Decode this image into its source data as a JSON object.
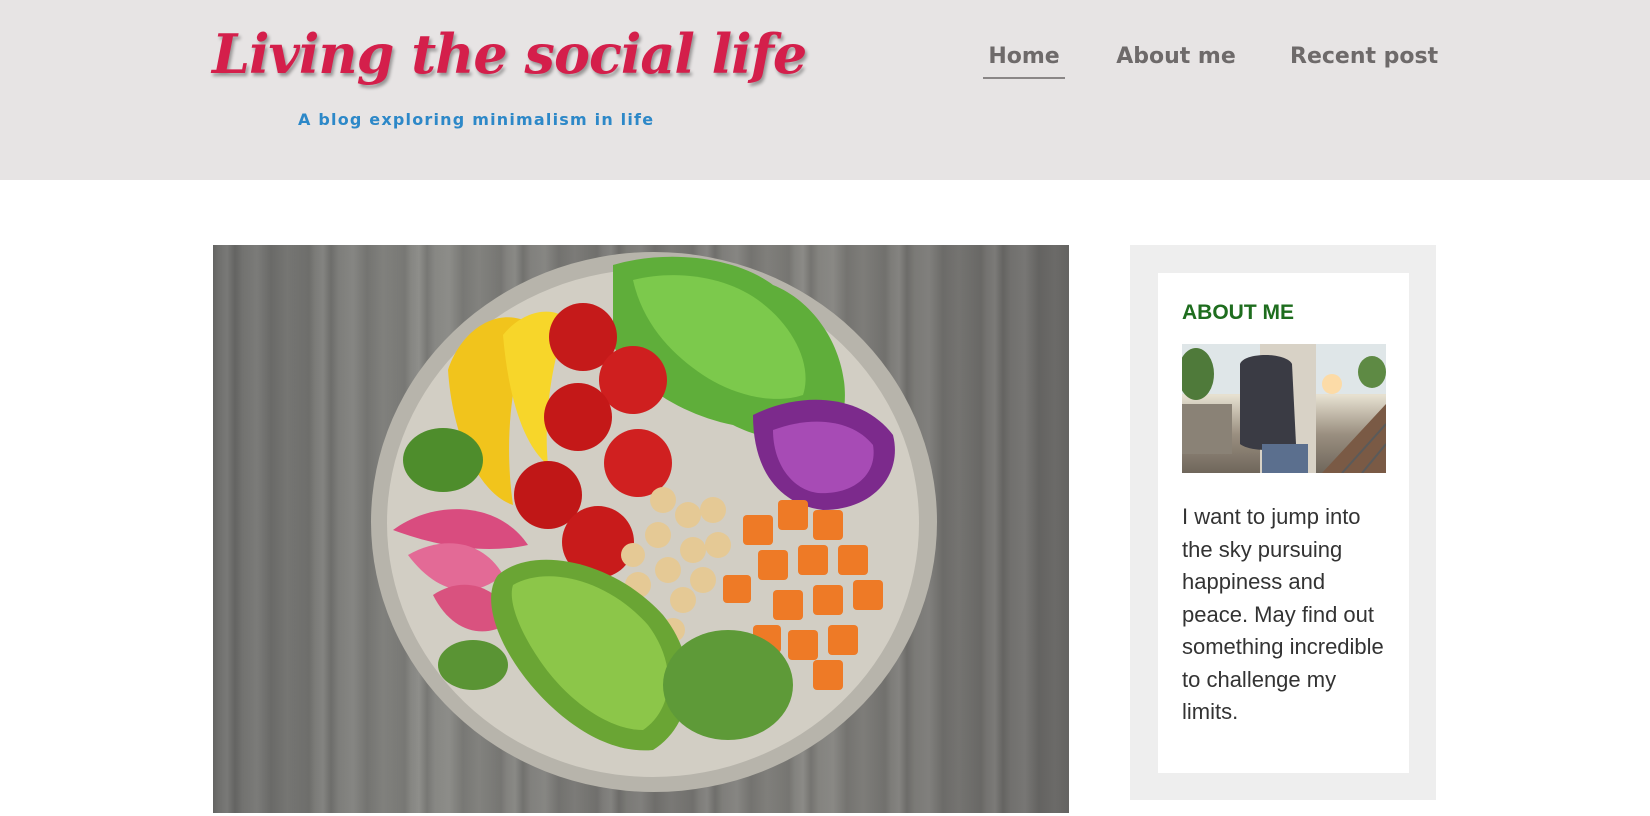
{
  "header": {
    "site_title": "Living the social life",
    "tagline": "A blog exploring minimalism in life",
    "background_color": "#e7e4e4",
    "title_color": "#d41f4b",
    "tagline_color": "#2d88c8"
  },
  "nav": {
    "items": [
      {
        "label": "Home",
        "active": true
      },
      {
        "label": "About me",
        "active": false
      },
      {
        "label": "Recent post",
        "active": false
      }
    ]
  },
  "hero": {
    "image": "salad-bowl-image"
  },
  "sidebar": {
    "heading": "ABOUT ME",
    "heading_color": "#1e6d1e",
    "photo": "backpacker-photo",
    "text": "I want to jump into the sky pursuing happiness and peace. May find out something incredible to challenge my limits."
  }
}
